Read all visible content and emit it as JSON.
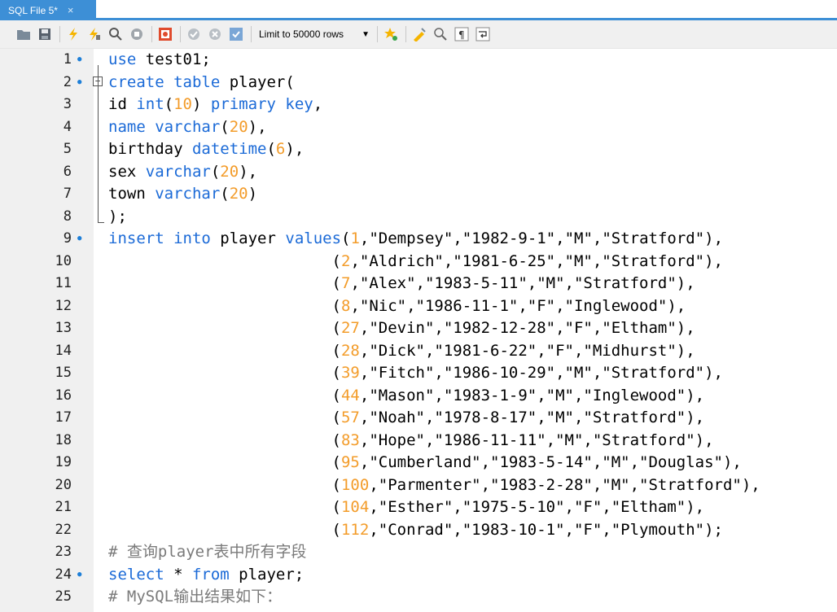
{
  "tab": {
    "title": "SQL File 5*",
    "close": "×"
  },
  "toolbar": {
    "limit_label": "Limit to 50000 rows",
    "icons": [
      "open-folder-icon",
      "save-icon",
      "execute-icon",
      "execute-selection-icon",
      "explain-icon",
      "stop-icon",
      "toggle-error-icon",
      "commit-icon",
      "rollback-icon",
      "autocommit-icon",
      "limit-dropdown",
      "add-snippet-icon",
      "beautify-icon",
      "find-icon",
      "invisible-chars-icon",
      "wrap-icon"
    ]
  },
  "colors": {
    "keyword": "#1b6ad7",
    "number": "#f39c2a",
    "comment": "#7a7a7a",
    "tab": "#3d8fd6"
  },
  "lines": [
    {
      "n": "1",
      "dot": true,
      "tokens": [
        [
          "kw",
          "use"
        ],
        [
          "plain",
          " test01;"
        ]
      ]
    },
    {
      "n": "2",
      "dot": true,
      "tokens": [
        [
          "kw",
          "create"
        ],
        [
          "plain",
          " "
        ],
        [
          "kw",
          "table"
        ],
        [
          "plain",
          " player("
        ]
      ]
    },
    {
      "n": "3",
      "dot": false,
      "tokens": [
        [
          "plain",
          "id "
        ],
        [
          "kw",
          "int"
        ],
        [
          "plain",
          "("
        ],
        [
          "num",
          "10"
        ],
        [
          "plain",
          ") "
        ],
        [
          "kw",
          "primary"
        ],
        [
          "plain",
          " "
        ],
        [
          "kw",
          "key"
        ],
        [
          "plain",
          ","
        ]
      ]
    },
    {
      "n": "4",
      "dot": false,
      "tokens": [
        [
          "kw",
          "name"
        ],
        [
          "plain",
          " "
        ],
        [
          "kw",
          "varchar"
        ],
        [
          "plain",
          "("
        ],
        [
          "num",
          "20"
        ],
        [
          "plain",
          "),"
        ]
      ]
    },
    {
      "n": "5",
      "dot": false,
      "tokens": [
        [
          "plain",
          "birthday "
        ],
        [
          "kw",
          "datetime"
        ],
        [
          "plain",
          "("
        ],
        [
          "num",
          "6"
        ],
        [
          "plain",
          "),"
        ]
      ]
    },
    {
      "n": "6",
      "dot": false,
      "tokens": [
        [
          "plain",
          "sex "
        ],
        [
          "kw",
          "varchar"
        ],
        [
          "plain",
          "("
        ],
        [
          "num",
          "20"
        ],
        [
          "plain",
          "),"
        ]
      ]
    },
    {
      "n": "7",
      "dot": false,
      "tokens": [
        [
          "plain",
          "town "
        ],
        [
          "kw",
          "varchar"
        ],
        [
          "plain",
          "("
        ],
        [
          "num",
          "20"
        ],
        [
          "plain",
          ")"
        ]
      ]
    },
    {
      "n": "8",
      "dot": false,
      "tokens": [
        [
          "plain",
          ");"
        ]
      ]
    },
    {
      "n": "9",
      "dot": true,
      "tokens": [
        [
          "kw",
          "insert"
        ],
        [
          "plain",
          " "
        ],
        [
          "kw",
          "into"
        ],
        [
          "plain",
          " player "
        ],
        [
          "kw",
          "values"
        ],
        [
          "plain",
          "("
        ],
        [
          "num",
          "1"
        ],
        [
          "plain",
          ",\"Dempsey\",\"1982-9-1\",\"M\",\"Stratford\"),"
        ]
      ]
    },
    {
      "n": "10",
      "dot": false,
      "tokens": [
        [
          "plain",
          "                        ("
        ],
        [
          "num",
          "2"
        ],
        [
          "plain",
          ",\"Aldrich\",\"1981-6-25\",\"M\",\"Stratford\"),"
        ]
      ]
    },
    {
      "n": "11",
      "dot": false,
      "tokens": [
        [
          "plain",
          "                        ("
        ],
        [
          "num",
          "7"
        ],
        [
          "plain",
          ",\"Alex\",\"1983-5-11\",\"M\",\"Stratford\"),"
        ]
      ]
    },
    {
      "n": "12",
      "dot": false,
      "tokens": [
        [
          "plain",
          "                        ("
        ],
        [
          "num",
          "8"
        ],
        [
          "plain",
          ",\"Nic\",\"1986-11-1\",\"F\",\"Inglewood\"),"
        ]
      ]
    },
    {
      "n": "13",
      "dot": false,
      "tokens": [
        [
          "plain",
          "                        ("
        ],
        [
          "num",
          "27"
        ],
        [
          "plain",
          ",\"Devin\",\"1982-12-28\",\"F\",\"Eltham\"),"
        ]
      ]
    },
    {
      "n": "14",
      "dot": false,
      "tokens": [
        [
          "plain",
          "                        ("
        ],
        [
          "num",
          "28"
        ],
        [
          "plain",
          ",\"Dick\",\"1981-6-22\",\"F\",\"Midhurst\"),"
        ]
      ]
    },
    {
      "n": "15",
      "dot": false,
      "tokens": [
        [
          "plain",
          "                        ("
        ],
        [
          "num",
          "39"
        ],
        [
          "plain",
          ",\"Fitch\",\"1986-10-29\",\"M\",\"Stratford\"),"
        ]
      ]
    },
    {
      "n": "16",
      "dot": false,
      "tokens": [
        [
          "plain",
          "                        ("
        ],
        [
          "num",
          "44"
        ],
        [
          "plain",
          ",\"Mason\",\"1983-1-9\",\"M\",\"Inglewood\"),"
        ]
      ]
    },
    {
      "n": "17",
      "dot": false,
      "tokens": [
        [
          "plain",
          "                        ("
        ],
        [
          "num",
          "57"
        ],
        [
          "plain",
          ",\"Noah\",\"1978-8-17\",\"M\",\"Stratford\"),"
        ]
      ]
    },
    {
      "n": "18",
      "dot": false,
      "tokens": [
        [
          "plain",
          "                        ("
        ],
        [
          "num",
          "83"
        ],
        [
          "plain",
          ",\"Hope\",\"1986-11-11\",\"M\",\"Stratford\"),"
        ]
      ]
    },
    {
      "n": "19",
      "dot": false,
      "tokens": [
        [
          "plain",
          "                        ("
        ],
        [
          "num",
          "95"
        ],
        [
          "plain",
          ",\"Cumberland\",\"1983-5-14\",\"M\",\"Douglas\"),"
        ]
      ]
    },
    {
      "n": "20",
      "dot": false,
      "tokens": [
        [
          "plain",
          "                        ("
        ],
        [
          "num",
          "100"
        ],
        [
          "plain",
          ",\"Parmenter\",\"1983-2-28\",\"M\",\"Stratford\"),"
        ]
      ]
    },
    {
      "n": "21",
      "dot": false,
      "tokens": [
        [
          "plain",
          "                        ("
        ],
        [
          "num",
          "104"
        ],
        [
          "plain",
          ",\"Esther\",\"1975-5-10\",\"F\",\"Eltham\"),"
        ]
      ]
    },
    {
      "n": "22",
      "dot": false,
      "tokens": [
        [
          "plain",
          "                        ("
        ],
        [
          "num",
          "112"
        ],
        [
          "plain",
          ",\"Conrad\",\"1983-10-1\",\"F\",\"Plymouth\");"
        ]
      ]
    },
    {
      "n": "23",
      "dot": false,
      "tokens": [
        [
          "cm",
          "# 查询player表中所有字段"
        ]
      ]
    },
    {
      "n": "24",
      "dot": true,
      "tokens": [
        [
          "kw",
          "select"
        ],
        [
          "plain",
          " * "
        ],
        [
          "kw",
          "from"
        ],
        [
          "plain",
          " player;"
        ]
      ]
    },
    {
      "n": "25",
      "dot": false,
      "tokens": [
        [
          "cm",
          "# MySQL输出结果如下："
        ]
      ]
    }
  ]
}
